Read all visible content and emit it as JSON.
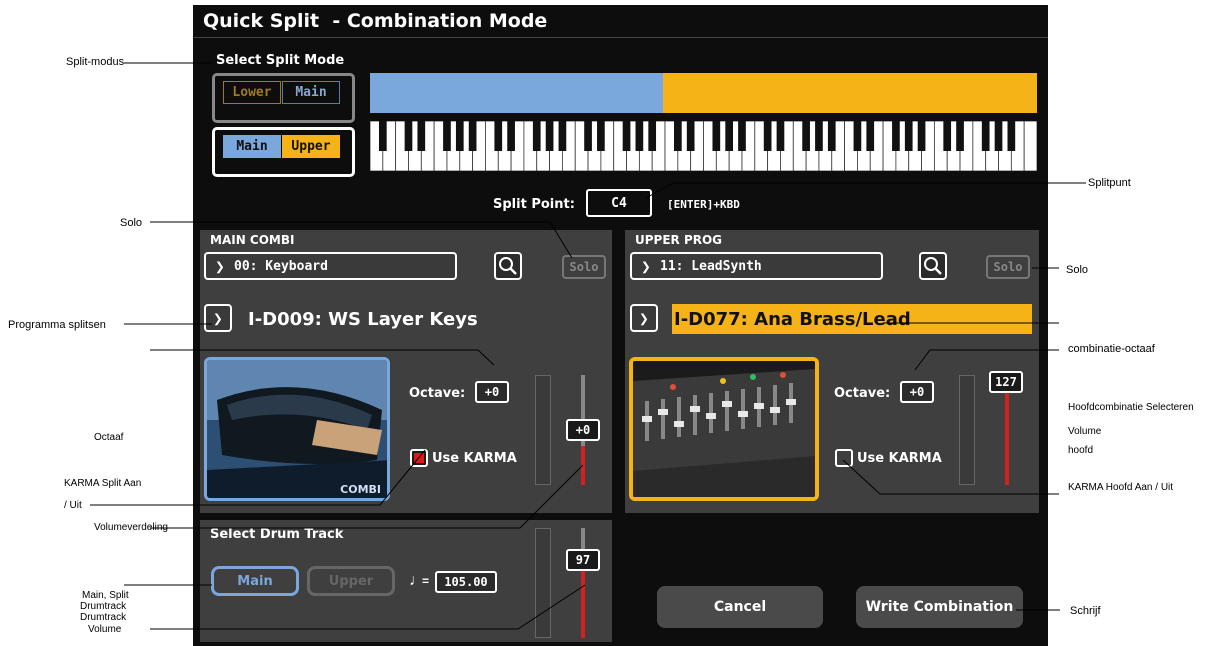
{
  "header": {
    "title": "Quick Split  - Combination Mode"
  },
  "split_mode": {
    "label": "Select Split Mode",
    "options": [
      {
        "left": "Lower",
        "right": "Main",
        "selected": false
      },
      {
        "left": "Main",
        "right": "Upper",
        "selected": true
      }
    ]
  },
  "keyboard": {
    "split_fraction": 0.44
  },
  "split_point": {
    "label": "Split Point:",
    "value": "C4",
    "hint": "[ENTER]+KBD"
  },
  "main_combi": {
    "title": "MAIN COMBI",
    "bank": "00: Keyboard",
    "solo_label": "Solo",
    "program": "I-D009: WS Layer Keys",
    "octave_label": "Octave:",
    "octave_value": "+0",
    "use_karma_label": "Use KARMA",
    "use_karma_checked": true,
    "image_caption": "COMBI",
    "volume_label": "+0",
    "volume_fraction": 0.35
  },
  "upper_prog": {
    "title": "UPPER PROG",
    "bank": "11: LeadSynth",
    "solo_label": "Solo",
    "program": "I-D077: Ana Brass/Lead",
    "octave_label": "Octave:",
    "octave_value": "+0",
    "use_karma_label": "Use KARMA",
    "use_karma_checked": false,
    "volume_label": "127",
    "volume_fraction": 1.0
  },
  "drum_track": {
    "title": "Select Drum Track",
    "main_label": "Main",
    "upper_label": "Upper",
    "tempo_value": "105.00",
    "volume_label": "97",
    "volume_fraction": 0.8
  },
  "buttons": {
    "cancel": "Cancel",
    "write": "Write Combination"
  },
  "annotations": {
    "split_mode": "Split-modus",
    "split_point": "Splitpunt",
    "solo_left": "Solo",
    "solo_right": "Solo",
    "program_split": "Programma splitsen",
    "combi_octave": "combinatie-octaaf",
    "main_combi_select": "Hoofdcombinatie Selecteren",
    "volume_main_1": "Volume",
    "volume_main_2": "hoofd",
    "octave": "Octaaf",
    "karma_split_1": "KARMA Split Aan",
    "karma_split_2": "/ Uit",
    "karma_main": "KARMA Hoofd Aan / Uit",
    "volume_split": "Volumeverdeling",
    "drum_1": "Main, Split",
    "drum_2": "Drumtrack",
    "drum_3": "Drumtrack",
    "drum_4": "Volume",
    "write": "Schrijf"
  },
  "colors": {
    "main": "#7aa7dc",
    "upper": "#f5b317",
    "volume": "#d61f1f",
    "karma_on": "#e01818"
  }
}
